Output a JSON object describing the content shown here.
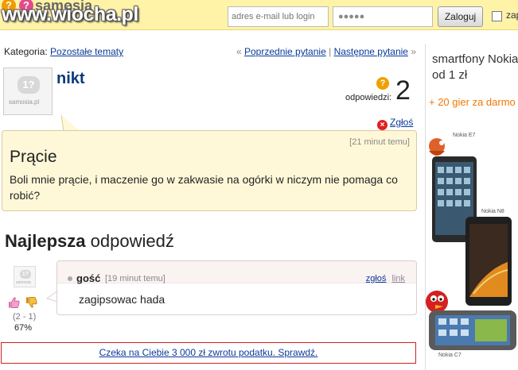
{
  "header": {
    "logo_icon_1": "?",
    "logo_icon_2": "?",
    "logo_text": "samosia",
    "watermark": "www.wiocha.pl",
    "email_placeholder": "adres e-mail lub login",
    "password_value": "●●●●●",
    "login_button": "Zaloguj",
    "remember_label": "zap"
  },
  "breadcrumb": {
    "label": "Kategoria:",
    "category": "Pozostałe tematy",
    "prev_arrow": "«",
    "prev": "Poprzednie pytanie",
    "separator": "|",
    "next": "Następne pytanie",
    "next_arrow": "»"
  },
  "question": {
    "avatar_glyph": "1?",
    "avatar_brand": "samosia.pl",
    "author": "nikt",
    "answers_icon": "?",
    "answers_label": "odpowiedzi:",
    "answers_count": "2",
    "report_icon": "×",
    "report": "Zgłoś",
    "time": "[21 minut temu]",
    "title": "Prącie",
    "body": "Boli mnie prącie, i maczenie go w zakwasie na ogórki w niczym nie pomaga co robić?"
  },
  "best_answer": {
    "heading_bold": "Najlepsza",
    "heading_rest": "odpowiedź",
    "avatar_glyph": "1?",
    "avatar_brand": "samosia",
    "author": "gość",
    "time": "[19 minut temu]",
    "report": "zgłoś",
    "link": "link",
    "text": "zagipsowac hada",
    "votes_range": "(2 - 1)",
    "votes_percent": "67%"
  },
  "promo": {
    "text": "Czeka na Ciebie 3 000 zł zwrotu podatku. Sprawdź."
  },
  "ad": {
    "title": "smartfony Nokia od 1 zł",
    "subtitle": "+ 20 gier za darmo",
    "phones": [
      "Nokia E7",
      "Nokia N8",
      "Nokia C7"
    ]
  },
  "colors": {
    "header_bg": "#fff3a8",
    "question_bg": "#fff8d8",
    "link": "#0a3a9a",
    "accent_orange": "#f07800",
    "promo_border": "#d02020"
  }
}
